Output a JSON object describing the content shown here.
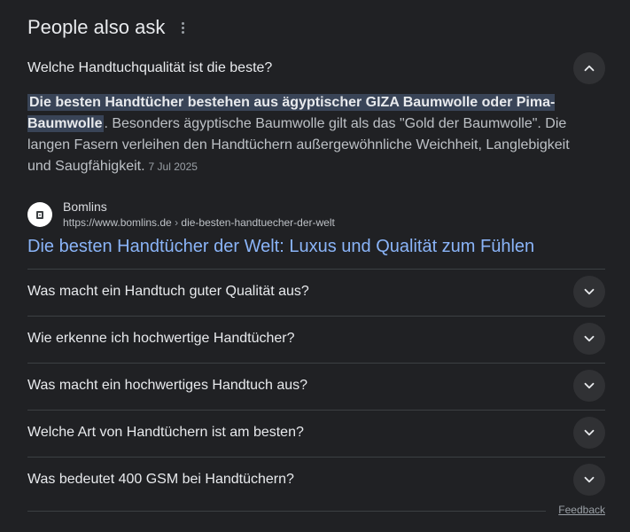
{
  "section": {
    "title": "People also ask"
  },
  "expanded": {
    "question": "Welche Handtuchqualität ist die beste?",
    "answer_highlight": "Die besten Handtücher bestehen aus ägyptischer GIZA Baumwolle oder Pima-Baumwolle",
    "answer_rest": ". Besonders ägyptische Baumwolle gilt als das \"Gold der Baumwolle\". Die langen Fasern verleihen den Handtüchern außergewöhnliche Weichheit, Langlebigkeit und Saugfähigkeit.",
    "date": "7 Jul 2025",
    "source_name": "Bomlins",
    "source_url": "https://www.bomlins.de",
    "source_path": "die-besten-handtuecher-der-welt",
    "url_separator": "›",
    "result_title": "Die besten Handtücher der Welt: Luxus und Qualität zum Fühlen",
    "chevron_icon": "chevron-up-icon"
  },
  "questions": [
    "Was macht ein Handtuch guter Qualität aus?",
    "Wie erkenne ich hochwertige Handtücher?",
    "Was macht ein hochwertiges Handtuch aus?",
    "Welche Art von Handtüchern ist am besten?",
    "Was bedeutet 400 GSM bei Handtüchern?"
  ],
  "footer": {
    "feedback_label": "Feedback"
  },
  "colors": {
    "background": "#202124",
    "text_primary": "#e8eaed",
    "text_secondary": "#bdc1c6",
    "link": "#8ab4f8",
    "highlight": "#394457",
    "chevron_bg": "#303134",
    "divider": "#3c4043"
  }
}
